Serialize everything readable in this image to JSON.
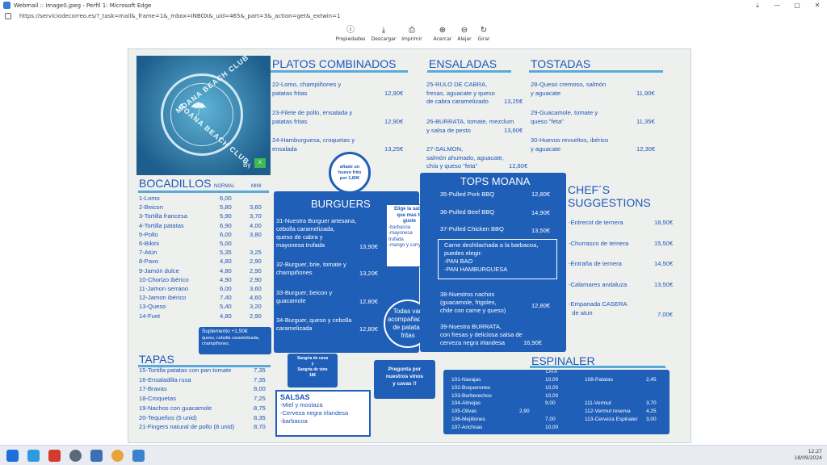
{
  "window": {
    "title": "Webmail :: image0.jpeg - Perfil 1: Microsoft Edge",
    "minimize": "—",
    "maximize": "▢",
    "close": "✕"
  },
  "address": {
    "url": "https://serviciodecorreo.es/?_task=mail&_frame=1&_mbox=INBOX&_uid=465&_part=3&_action=get&_extwin=1"
  },
  "toolbar": [
    {
      "label": "Propiedades",
      "icon": "info-icon"
    },
    {
      "label": "Descargar",
      "icon": "download-icon"
    },
    {
      "label": "Imprimir",
      "icon": "print-icon"
    },
    {
      "label": "Acercar",
      "icon": "zoom-in-icon"
    },
    {
      "label": "Alejar",
      "icon": "zoom-out-icon"
    },
    {
      "label": "Girar",
      "icon": "rotate-icon"
    }
  ],
  "logo": {
    "top_text": "MOANA BEACH CLUB",
    "bottom_text": "MOANA BEACH CLUB",
    "by": "By"
  },
  "platos": {
    "title": "PLATOS COMBINADOS",
    "items": [
      {
        "l1": "22-Lomo, champiñones y",
        "l2": "patatas fritas",
        "price": "12,90€"
      },
      {
        "l1": "23-Filete de pollo, ensalada y",
        "l2": "patatas fritas",
        "price": "12,90€"
      },
      {
        "l1": "24-Hamburguesa, croquetas y",
        "l2": "ensalada",
        "price": "13,25€"
      }
    ]
  },
  "ensaladas": {
    "title": "ENSALADAS",
    "items": [
      {
        "l1": "25-RULO DE CABRA,",
        "l2": "fresas, aguacate y queso",
        "l3": "de cabra caramelizado",
        "price": "13,25€"
      },
      {
        "l1": "26-BURRATA, tomate, mezclum",
        "l2": "y salsa de pesto",
        "price": "13,60€"
      },
      {
        "l1": "27-SALMON,",
        "l2": "salmón ahumado, aguacate,",
        "l3": "chía y queso \"feta\"",
        "price": "12,80€"
      }
    ]
  },
  "tostadas": {
    "title": "TOSTADAS",
    "items": [
      {
        "l1": "28-Queso cremoso, salmón",
        "l2": "y aguacate",
        "price": "11,90€"
      },
      {
        "l1": "29-Guacamole, tomate y",
        "l2": "queso \"feta\"",
        "price": "11,35€"
      },
      {
        "l1": "30-Huevos revueltos, ibérico",
        "l2": "y aguacate",
        "price": "12,30€"
      }
    ]
  },
  "egg_badge": {
    "l1": "añade un",
    "l2": "huevo frito",
    "l3": "por 1,80€"
  },
  "bocadillos": {
    "title": "BOCADILLOS",
    "col_normal": "NORMAL",
    "col_mini": "MINI",
    "items": [
      {
        "name": "1-Lomo",
        "normal": "6,00",
        "mini": ""
      },
      {
        "name": "2-Beicon",
        "normal": "5,80",
        "mini": "3,60"
      },
      {
        "name": "3-Tortilla francesa",
        "normal": "5,90",
        "mini": "3,70"
      },
      {
        "name": "4-Tortilla patatas",
        "normal": "6,90",
        "mini": "4,00"
      },
      {
        "name": "5-Pollo",
        "normal": "6,00",
        "mini": "3,80"
      },
      {
        "name": "6-Bikini",
        "normal": "5,00",
        "mini": ""
      },
      {
        "name": "7-Atún",
        "normal": "5,35",
        "mini": "3,25"
      },
      {
        "name": "8-Pavo",
        "normal": "4,80",
        "mini": "2,90"
      },
      {
        "name": "9-Jamón dulce",
        "normal": "4,80",
        "mini": "2,90"
      },
      {
        "name": "10-Chorizo ibérico",
        "normal": "4,90",
        "mini": "2,90"
      },
      {
        "name": "11-Jamon serrano",
        "normal": "6,00",
        "mini": "3,60"
      },
      {
        "name": "12-Jamon ibérico",
        "normal": "7,40",
        "mini": "4,60"
      },
      {
        "name": "13-Queso",
        "normal": "5,40",
        "mini": "3,20"
      },
      {
        "name": "14-Fuet",
        "normal": "4,80",
        "mini": "2,90"
      }
    ],
    "supplement": {
      "l1": "Suplemento +1,50€",
      "l2": "queso, cebolla caramelizada,",
      "l3": "champiñones."
    }
  },
  "burguers": {
    "title": "BURGUERS",
    "items": [
      {
        "l1": "31-Nuestra Burguer artesana,",
        "l2": "cebolla caramelizada,",
        "l3": "queso de cabra y",
        "l4": "mayonesa trufada",
        "price": "13,90€"
      },
      {
        "l1": "32-Burguer, brie, tomate y",
        "l2": "champiñones",
        "price": "13,20€"
      },
      {
        "l1": "33-Burguer, beicon y",
        "l2": "guacamole",
        "price": "12,80€"
      },
      {
        "l1": "34-Burguer, queso y cebolla",
        "l2": "caramelizada",
        "price": "12,80€"
      }
    ],
    "sauce_box": {
      "title1": "Elige la salsa",
      "title2": "que mas te",
      "title3": "guste",
      "o1": "-barbacoa",
      "o2": "-mayonesa",
      "o3": "trufada",
      "o4": "-mango y curry"
    },
    "fries_badge": {
      "l1": "Todas van",
      "l2": "acompañadas",
      "l3": "de patatas",
      "l4": "fritas"
    }
  },
  "tops": {
    "title": "TOPS MOANA",
    "items": [
      {
        "name": "35-Pulled Pork BBQ",
        "price": "12,80€"
      },
      {
        "name": "36-Pulled Beef BBQ",
        "price": "14,90€"
      },
      {
        "name": "37-Pulled Chicken BBQ",
        "price": "13,50€"
      }
    ],
    "note": {
      "l1": "Carne deshilachada a la barbacoa,",
      "l2": "puedes elegir:",
      "l3": "-PAN BAO",
      "l4": "-PAN HAMBURGUESA"
    },
    "extra": [
      {
        "l1": "38-Nuestros nachos",
        "l2": "(guacamole, frigoles,",
        "l3": "chile con carne y queso)",
        "price": "12,80€"
      },
      {
        "l1": "39-Nuestra BURRATA,",
        "l2": "con fresas y deliciosa salsa de",
        "l3": "cerveza negra irlandesa",
        "price": "16,90€"
      }
    ]
  },
  "chef": {
    "title": "CHEF´S SUGGESTIONS",
    "items": [
      {
        "name": "-Entrecot de ternera",
        "name2": "",
        "price": "18,50€"
      },
      {
        "name": "-Churrasco de ternera",
        "name2": "",
        "price": "15,50€"
      },
      {
        "name": "-Entraña de ternera",
        "name2": "",
        "price": "14,50€"
      },
      {
        "name": "-Calamares andaluza",
        "name2": "",
        "price": "13,50€"
      },
      {
        "name": "-Empanada CASERA",
        "name2": "de atun",
        "price": "7,00€"
      }
    ]
  },
  "tapas": {
    "title": "TAPAS",
    "items": [
      {
        "name": "15-Tortilla patatas con pan tomate",
        "price": "7,35"
      },
      {
        "name": "16-Ensaladilla rusa",
        "price": "7,35"
      },
      {
        "name": "17-Bravas",
        "price": "8,00"
      },
      {
        "name": "18-Croquetas",
        "price": "7,25"
      },
      {
        "name": "19-Nachos con guacamole",
        "price": "8,75"
      },
      {
        "name": "20-Tequeños (5 unid)",
        "price": "8,35"
      },
      {
        "name": "21-Fingers natural de pollo (8 unid)",
        "price": "8,70"
      }
    ]
  },
  "sangria": {
    "l1": "Sangria de cava",
    "l2": "y",
    "l3": "Sangria de vino",
    "l4": "18€"
  },
  "salsas": {
    "title": "SALSAS",
    "items": [
      "-Miel y mostaza",
      "-Cerveza negra irlandesa",
      "-barbacoa"
    ]
  },
  "vinos": {
    "l1": "Pregunta por",
    "l2": "nuestros vinos",
    "l3": "y cavas !!"
  },
  "espinaler": {
    "title": "ESPINALER",
    "col": "LATA",
    "left": [
      {
        "name": "101-Navajas",
        "extra": "",
        "price": "10,00"
      },
      {
        "name": "102-Boquerones",
        "extra": "",
        "price": "10,00"
      },
      {
        "name": "103-Berberechos",
        "extra": "",
        "price": "10,00"
      },
      {
        "name": "104-Almejas",
        "extra": "",
        "price": "9,00"
      },
      {
        "name": "105-Olivas",
        "extra": "2,90",
        "price": ""
      },
      {
        "name": "106-Mejillones",
        "extra": "",
        "price": "7,00"
      },
      {
        "name": "107-Anchoas",
        "extra": "",
        "price": "10,00"
      }
    ],
    "right": [
      {
        "name": "108-Patatas",
        "price": "2,45"
      },
      {
        "name": "111-Vermut",
        "price": "3,70"
      },
      {
        "name": "112-Vermut reserva",
        "price": "4,25"
      },
      {
        "name": "113-Cerveza Espinaler",
        "price": "3,00"
      }
    ]
  },
  "taskbar": {
    "time": "12:27",
    "date": "18/09/2024"
  }
}
